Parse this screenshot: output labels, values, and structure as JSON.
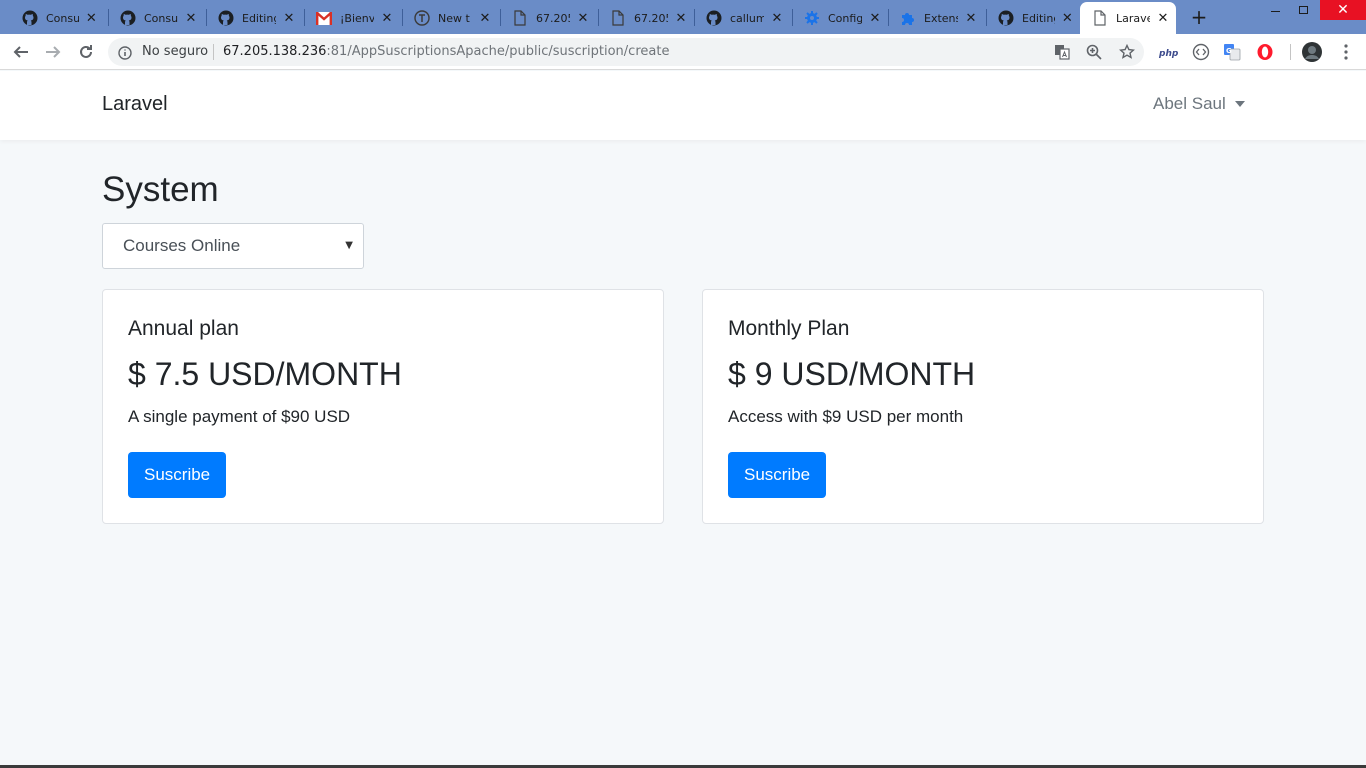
{
  "browser": {
    "tabs": [
      {
        "title": "Consu",
        "icon": "github-icon"
      },
      {
        "title": "Consu",
        "icon": "github-icon"
      },
      {
        "title": "Editing",
        "icon": "github-icon"
      },
      {
        "title": "¡Bienv",
        "icon": "gmail-icon"
      },
      {
        "title": "New t",
        "icon": "t-circle-icon"
      },
      {
        "title": "67.205",
        "icon": "document-icon"
      },
      {
        "title": "67.205",
        "icon": "document-icon"
      },
      {
        "title": "callum",
        "icon": "github-icon"
      },
      {
        "title": "Config",
        "icon": "gear-icon"
      },
      {
        "title": "Extens",
        "icon": "puzzle-icon"
      },
      {
        "title": "Editing",
        "icon": "github-icon"
      },
      {
        "title": "Larave",
        "icon": "document-icon",
        "active": true
      }
    ],
    "new_tab_label": "+",
    "close_glyph": "✕",
    "address": {
      "security_label": "No seguro",
      "host": "67.205.138.236",
      "rest": ":81/AppSuscriptionsApache/public/suscription/create"
    },
    "extensions": [
      "php-icon",
      "code-icon",
      "translate-icon",
      "opera-icon"
    ],
    "colors": {
      "tabstrip": "#6a8cc7",
      "active_tab": "#ffffff",
      "close_button": "#e81123"
    }
  },
  "navbar": {
    "brand": "Laravel",
    "user_name": "Abel Saul"
  },
  "main": {
    "title": "System",
    "system_select": {
      "value": "Courses Online"
    },
    "plans": [
      {
        "title": "Annual plan",
        "price": "$ 7.5 USD/MONTH",
        "description": "A single payment of $90 USD",
        "button_label": "Suscribe"
      },
      {
        "title": "Monthly Plan",
        "price": "$ 9 USD/MONTH",
        "description": "Access with $9 USD per month",
        "button_label": "Suscribe"
      }
    ],
    "colors": {
      "primary": "#007bff",
      "page_bg": "#f5f8fa"
    }
  }
}
